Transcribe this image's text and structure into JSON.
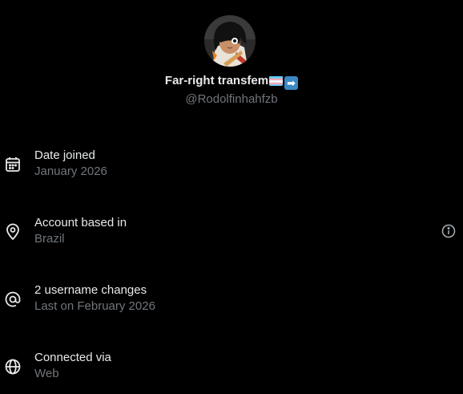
{
  "profile": {
    "display_name": "Far-right transfem",
    "handle": "@Rodolfinhahfzb"
  },
  "about": {
    "rows": [
      {
        "icon": "calendar-icon",
        "title": "Date joined",
        "subtitle": "January 2026"
      },
      {
        "icon": "location-pin-icon",
        "title": "Account based in",
        "subtitle": "Brazil"
      },
      {
        "icon": "at-sign-icon",
        "title": "2 username changes",
        "subtitle": "Last on February 2026"
      },
      {
        "icon": "globe-icon",
        "title": "Connected via",
        "subtitle": "Web"
      }
    ]
  },
  "colors": {
    "background": "#000000",
    "primary_text": "#e7e9ea",
    "secondary_text": "#71767b"
  }
}
